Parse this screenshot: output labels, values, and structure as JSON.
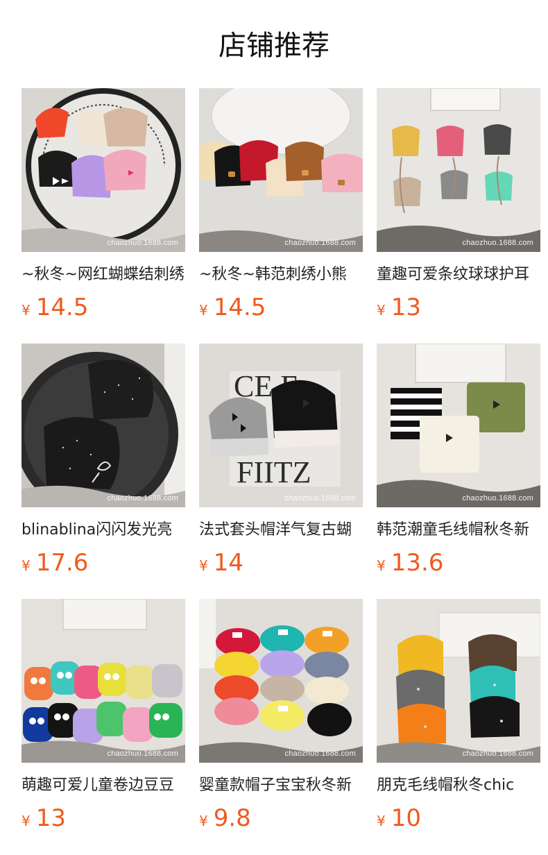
{
  "page_title": "店铺推荐",
  "currency_symbol": "¥",
  "watermark": "chaozhuo.1688.com",
  "accent_color": "#ef5a1e",
  "products": [
    {
      "name": "~秋冬~网红蝴蝶结刺绣",
      "price": "14.5"
    },
    {
      "name": "~秋冬~韩范刺绣小熊",
      "price": "14.5"
    },
    {
      "name": "童趣可爱条纹球球护耳",
      "price": "13"
    },
    {
      "name": "blinablina闪闪发光亮",
      "price": "17.6"
    },
    {
      "name": "法式套头帽洋气复古蝴",
      "price": "14"
    },
    {
      "name": "韩范潮童毛线帽秋冬新",
      "price": "13.6"
    },
    {
      "name": "萌趣可爱儿童卷边豆豆",
      "price": "13"
    },
    {
      "name": "婴童款帽子宝宝秋冬新",
      "price": "9.8"
    },
    {
      "name": "朋克毛线帽秋冬chic",
      "price": "10"
    }
  ]
}
